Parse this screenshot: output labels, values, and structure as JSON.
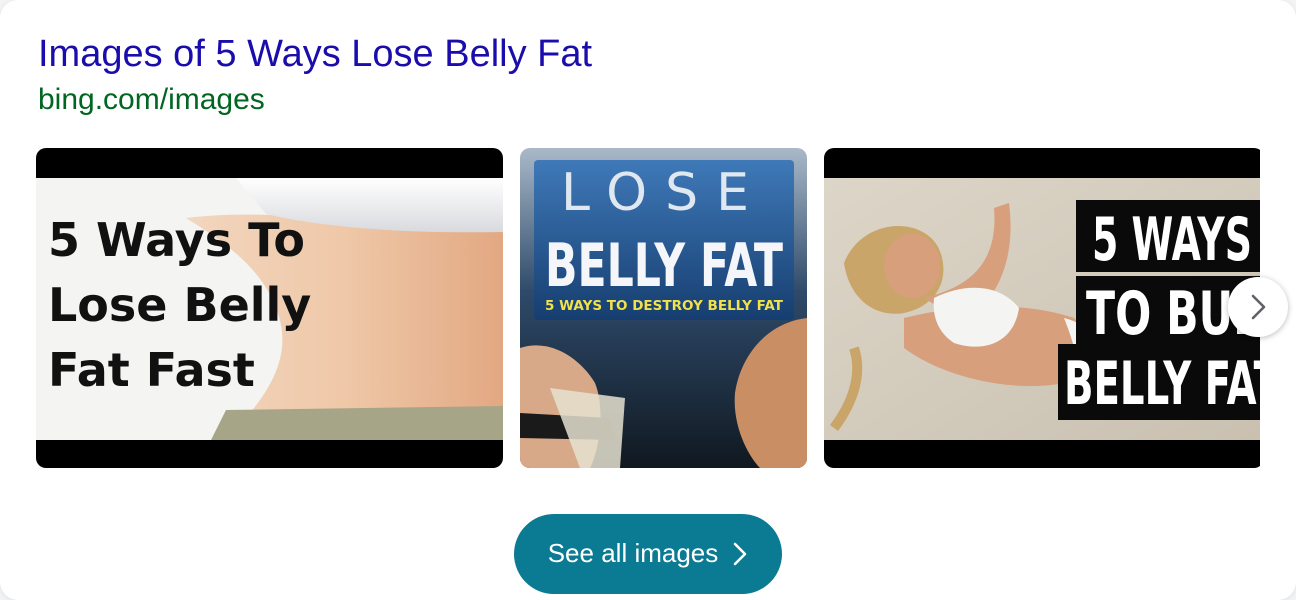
{
  "result": {
    "title": "Images of 5 Ways Lose Belly Fat",
    "source": "bing.com/images"
  },
  "images": [
    {
      "lines": [
        "5 Ways To",
        "Lose Belly",
        "Fat Fast"
      ]
    },
    {
      "top": "LOSE",
      "main": "BELLY FAT",
      "sub": "5 WAYS TO DESTROY BELLY FAT"
    },
    {
      "lines": [
        "5 WAYS",
        "TO BUR",
        "BELLY FAT"
      ]
    }
  ],
  "controls": {
    "next_icon": "chevron-right-icon",
    "see_all_label": "See all images"
  },
  "colors": {
    "title": "#1a0dab",
    "source": "#006621",
    "button": "#0b7a93"
  }
}
